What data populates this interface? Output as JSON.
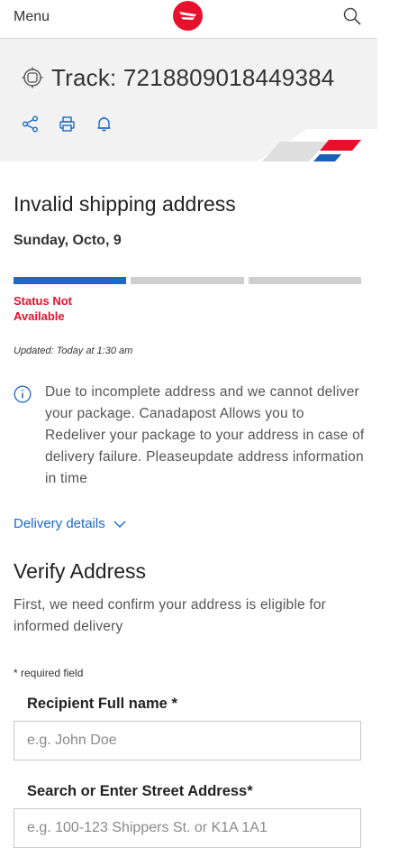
{
  "header": {
    "menu_label": "Menu",
    "logo_icon": "canada-post-logo",
    "search_icon": "search-icon",
    "brand_red": "#e8112d"
  },
  "tracking": {
    "title": "Track: 7218809018449384",
    "actions": [
      "share-icon",
      "print-icon",
      "bell-icon"
    ],
    "accent": "#1c69c7"
  },
  "status": {
    "heading": "Invalid shipping address",
    "date": "Sunday, Octo, 9",
    "progress": [
      1,
      0,
      0
    ],
    "progress_fraction": 0.33,
    "status_text": "Status Not Available",
    "updated": "Updated: Today at 1:30 am",
    "info": "Due to incomplete address and we cannot deliver your package. Canadapost Allows you to Redeliver your package to your address in case of delivery failure. Pleaseupdate address information in time",
    "delivery_details": "Delivery details"
  },
  "verify": {
    "heading": "Verify Address",
    "description": "First, we need confirm your address is eligible for informed delivery",
    "required_note": "* required field",
    "name_label": "Recipient Full name *",
    "name_placeholder": "e.g. John Doe",
    "name_value": "",
    "address_label": "Search or Enter Street Address*",
    "address_placeholder": "e.g. 100-123 Shippers St. or K1A 1A1",
    "address_value": ""
  }
}
